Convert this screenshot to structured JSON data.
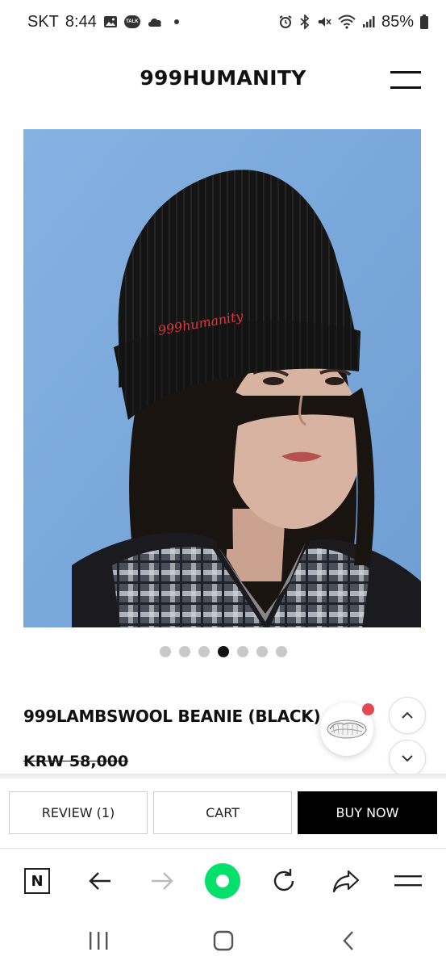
{
  "status_bar": {
    "carrier": "SKT",
    "time": "8:44",
    "kakao_talk_label": "TALK",
    "battery": "85%",
    "icons_left": [
      "gallery-icon",
      "kakaotalk-icon",
      "cloud-icon",
      "dot"
    ],
    "icons_right": [
      "alarm-icon",
      "bluetooth-icon",
      "mute-icon",
      "wifi-icon",
      "signal-icon",
      "battery-icon"
    ]
  },
  "header": {
    "brand": "999HUMANITY",
    "menu_icon": "hamburger-menu-icon"
  },
  "hero": {
    "description_icon": "product-photo",
    "embroidery": "999humanity",
    "bg_color": "#7aa6d8",
    "beanie_color": "#141414",
    "accent": "#e0343f"
  },
  "carousel": {
    "count": 7,
    "active_index": 3
  },
  "product": {
    "title": "999LAMBSWOOL BEANIE (BLACK)",
    "price": "KRW 58,000"
  },
  "floating": {
    "scroll_up_icon": "chevron-up-icon",
    "scroll_down_icon": "chevron-down-icon",
    "badge_color": "#e5484d"
  },
  "actions": {
    "review_label": "REVIEW (1)",
    "cart_label": "CART",
    "buy_label": "BUY NOW"
  },
  "browser": {
    "home_label": "N",
    "items": [
      "naver-home-icon",
      "back-arrow-icon",
      "forward-arrow-icon",
      "green-dot-icon",
      "refresh-icon",
      "share-icon",
      "menu-icon"
    ],
    "accent": "#03e06c"
  },
  "system_nav": {
    "items": [
      "recent-apps-icon",
      "home-icon",
      "back-icon"
    ]
  }
}
